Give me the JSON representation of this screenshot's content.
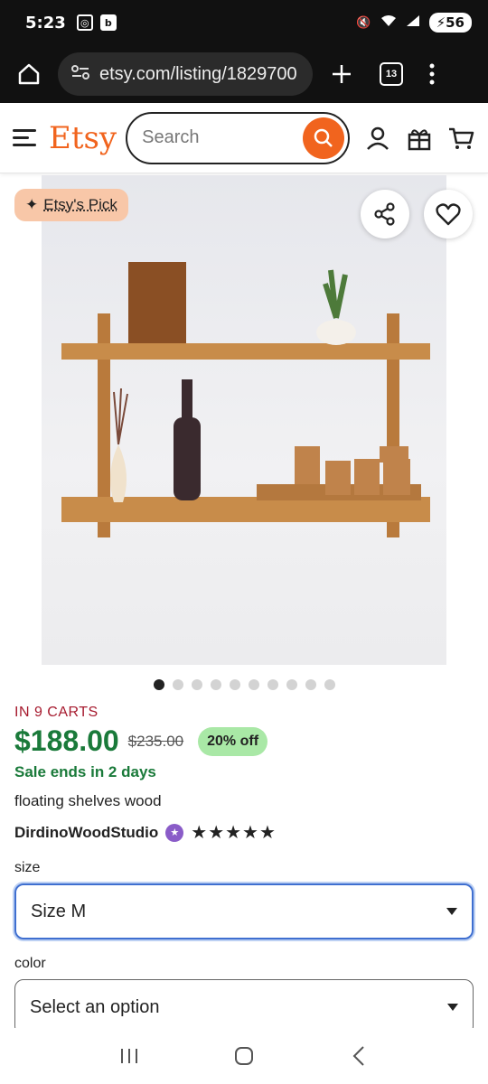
{
  "status_bar": {
    "time": "5:23",
    "badge_b": "b",
    "battery": "56"
  },
  "browser": {
    "url": "etsy.com/listing/1829700",
    "tab_count": "13"
  },
  "header": {
    "logo": "Etsy",
    "search_placeholder": "Search"
  },
  "image": {
    "badge": "Etsy's Pick",
    "dots_total": 10,
    "active_dot": 0
  },
  "product": {
    "in_carts": "IN 9 CARTS",
    "price": "$188.00",
    "old_price": "$235.00",
    "discount": "20% off",
    "sale_ends": "Sale ends in 2 days",
    "title": "floating shelves wood",
    "shop": "DirdinoWoodStudio",
    "rating_stars": "★★★★★"
  },
  "options": {
    "size_label": "size",
    "size_value": "Size M",
    "color_label": "color",
    "color_value": "Select an option"
  },
  "colors": {
    "etsy_orange": "#f1641e",
    "price_green": "#1a7a3a",
    "carts_red": "#a61a2e"
  }
}
